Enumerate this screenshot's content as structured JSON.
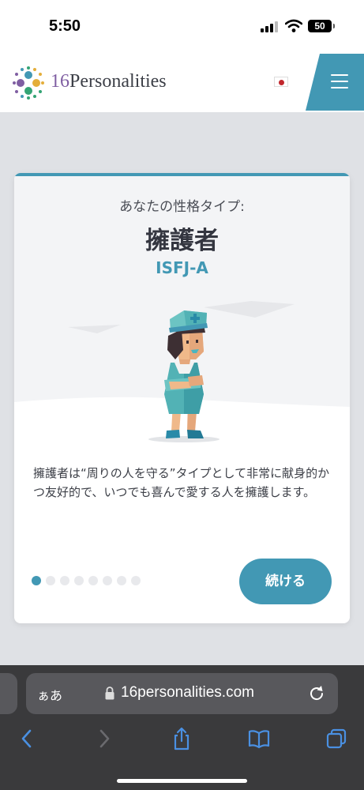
{
  "status_bar": {
    "time": "5:50",
    "battery": "50"
  },
  "header": {
    "logo_num": "16",
    "logo_word": "Personalities",
    "flag": "japan-flag",
    "menu": "menu-icon"
  },
  "card": {
    "label": "あなたの性格タイプ:",
    "title": "擁護者",
    "code": "ISFJ-A",
    "description": "擁護者は“周りの人を守る”タイプとして非常に献身的かつ友好的で、いつでも喜んで愛する人を擁護します。",
    "pagination": {
      "total": 8,
      "current": 1
    },
    "continue_label": "続ける"
  },
  "browser": {
    "aa_label": "ぁあ",
    "url": "16personalities.com"
  },
  "colors": {
    "accent": "#4298b4",
    "purple": "#7f5ea2",
    "browser_bar": "#3a3a3c"
  }
}
